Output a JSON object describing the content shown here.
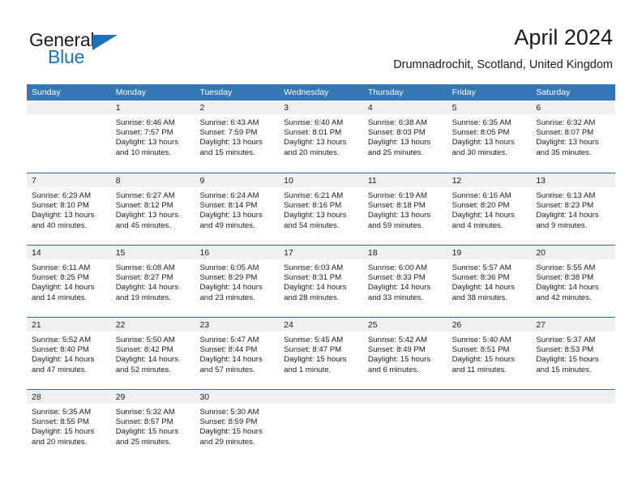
{
  "brand": {
    "word_one": "General",
    "word_two": "Blue",
    "triangle_color": "#1b72b8"
  },
  "header": {
    "title": "April 2024",
    "subtitle": "Drumnadrochit, Scotland, United Kingdom"
  },
  "theme": {
    "header_row_bg": "#3576b4",
    "week_separator": "#2b6ca9",
    "day_number_strip_bg": "#f0f0f0",
    "text": "#1b1b1b"
  },
  "weekday_headers": [
    "Sunday",
    "Monday",
    "Tuesday",
    "Wednesday",
    "Thursday",
    "Friday",
    "Saturday"
  ],
  "weeks": [
    [
      {
        "day": "",
        "sunrise": "",
        "sunset": "",
        "daylight_line1": "",
        "daylight_line2": "",
        "empty": true
      },
      {
        "day": "1",
        "sunrise": "Sunrise: 6:46 AM",
        "sunset": "Sunset: 7:57 PM",
        "daylight_line1": "Daylight: 13 hours",
        "daylight_line2": "and 10 minutes."
      },
      {
        "day": "2",
        "sunrise": "Sunrise: 6:43 AM",
        "sunset": "Sunset: 7:59 PM",
        "daylight_line1": "Daylight: 13 hours",
        "daylight_line2": "and 15 minutes."
      },
      {
        "day": "3",
        "sunrise": "Sunrise: 6:40 AM",
        "sunset": "Sunset: 8:01 PM",
        "daylight_line1": "Daylight: 13 hours",
        "daylight_line2": "and 20 minutes."
      },
      {
        "day": "4",
        "sunrise": "Sunrise: 6:38 AM",
        "sunset": "Sunset: 8:03 PM",
        "daylight_line1": "Daylight: 13 hours",
        "daylight_line2": "and 25 minutes."
      },
      {
        "day": "5",
        "sunrise": "Sunrise: 6:35 AM",
        "sunset": "Sunset: 8:05 PM",
        "daylight_line1": "Daylight: 13 hours",
        "daylight_line2": "and 30 minutes."
      },
      {
        "day": "6",
        "sunrise": "Sunrise: 6:32 AM",
        "sunset": "Sunset: 8:07 PM",
        "daylight_line1": "Daylight: 13 hours",
        "daylight_line2": "and 35 minutes."
      }
    ],
    [
      {
        "day": "7",
        "sunrise": "Sunrise: 6:29 AM",
        "sunset": "Sunset: 8:10 PM",
        "daylight_line1": "Daylight: 13 hours",
        "daylight_line2": "and 40 minutes."
      },
      {
        "day": "8",
        "sunrise": "Sunrise: 6:27 AM",
        "sunset": "Sunset: 8:12 PM",
        "daylight_line1": "Daylight: 13 hours",
        "daylight_line2": "and 45 minutes."
      },
      {
        "day": "9",
        "sunrise": "Sunrise: 6:24 AM",
        "sunset": "Sunset: 8:14 PM",
        "daylight_line1": "Daylight: 13 hours",
        "daylight_line2": "and 49 minutes."
      },
      {
        "day": "10",
        "sunrise": "Sunrise: 6:21 AM",
        "sunset": "Sunset: 8:16 PM",
        "daylight_line1": "Daylight: 13 hours",
        "daylight_line2": "and 54 minutes."
      },
      {
        "day": "11",
        "sunrise": "Sunrise: 6:19 AM",
        "sunset": "Sunset: 8:18 PM",
        "daylight_line1": "Daylight: 13 hours",
        "daylight_line2": "and 59 minutes."
      },
      {
        "day": "12",
        "sunrise": "Sunrise: 6:16 AM",
        "sunset": "Sunset: 8:20 PM",
        "daylight_line1": "Daylight: 14 hours",
        "daylight_line2": "and 4 minutes."
      },
      {
        "day": "13",
        "sunrise": "Sunrise: 6:13 AM",
        "sunset": "Sunset: 8:23 PM",
        "daylight_line1": "Daylight: 14 hours",
        "daylight_line2": "and 9 minutes."
      }
    ],
    [
      {
        "day": "14",
        "sunrise": "Sunrise: 6:11 AM",
        "sunset": "Sunset: 8:25 PM",
        "daylight_line1": "Daylight: 14 hours",
        "daylight_line2": "and 14 minutes."
      },
      {
        "day": "15",
        "sunrise": "Sunrise: 6:08 AM",
        "sunset": "Sunset: 8:27 PM",
        "daylight_line1": "Daylight: 14 hours",
        "daylight_line2": "and 19 minutes."
      },
      {
        "day": "16",
        "sunrise": "Sunrise: 6:05 AM",
        "sunset": "Sunset: 8:29 PM",
        "daylight_line1": "Daylight: 14 hours",
        "daylight_line2": "and 23 minutes."
      },
      {
        "day": "17",
        "sunrise": "Sunrise: 6:03 AM",
        "sunset": "Sunset: 8:31 PM",
        "daylight_line1": "Daylight: 14 hours",
        "daylight_line2": "and 28 minutes."
      },
      {
        "day": "18",
        "sunrise": "Sunrise: 6:00 AM",
        "sunset": "Sunset: 8:33 PM",
        "daylight_line1": "Daylight: 14 hours",
        "daylight_line2": "and 33 minutes."
      },
      {
        "day": "19",
        "sunrise": "Sunrise: 5:57 AM",
        "sunset": "Sunset: 8:36 PM",
        "daylight_line1": "Daylight: 14 hours",
        "daylight_line2": "and 38 minutes."
      },
      {
        "day": "20",
        "sunrise": "Sunrise: 5:55 AM",
        "sunset": "Sunset: 8:38 PM",
        "daylight_line1": "Daylight: 14 hours",
        "daylight_line2": "and 42 minutes."
      }
    ],
    [
      {
        "day": "21",
        "sunrise": "Sunrise: 5:52 AM",
        "sunset": "Sunset: 8:40 PM",
        "daylight_line1": "Daylight: 14 hours",
        "daylight_line2": "and 47 minutes."
      },
      {
        "day": "22",
        "sunrise": "Sunrise: 5:50 AM",
        "sunset": "Sunset: 8:42 PM",
        "daylight_line1": "Daylight: 14 hours",
        "daylight_line2": "and 52 minutes."
      },
      {
        "day": "23",
        "sunrise": "Sunrise: 5:47 AM",
        "sunset": "Sunset: 8:44 PM",
        "daylight_line1": "Daylight: 14 hours",
        "daylight_line2": "and 57 minutes."
      },
      {
        "day": "24",
        "sunrise": "Sunrise: 5:45 AM",
        "sunset": "Sunset: 8:47 PM",
        "daylight_line1": "Daylight: 15 hours",
        "daylight_line2": "and 1 minute."
      },
      {
        "day": "25",
        "sunrise": "Sunrise: 5:42 AM",
        "sunset": "Sunset: 8:49 PM",
        "daylight_line1": "Daylight: 15 hours",
        "daylight_line2": "and 6 minutes."
      },
      {
        "day": "26",
        "sunrise": "Sunrise: 5:40 AM",
        "sunset": "Sunset: 8:51 PM",
        "daylight_line1": "Daylight: 15 hours",
        "daylight_line2": "and 11 minutes."
      },
      {
        "day": "27",
        "sunrise": "Sunrise: 5:37 AM",
        "sunset": "Sunset: 8:53 PM",
        "daylight_line1": "Daylight: 15 hours",
        "daylight_line2": "and 15 minutes."
      }
    ],
    [
      {
        "day": "28",
        "sunrise": "Sunrise: 5:35 AM",
        "sunset": "Sunset: 8:55 PM",
        "daylight_line1": "Daylight: 15 hours",
        "daylight_line2": "and 20 minutes."
      },
      {
        "day": "29",
        "sunrise": "Sunrise: 5:32 AM",
        "sunset": "Sunset: 8:57 PM",
        "daylight_line1": "Daylight: 15 hours",
        "daylight_line2": "and 25 minutes."
      },
      {
        "day": "30",
        "sunrise": "Sunrise: 5:30 AM",
        "sunset": "Sunset: 8:59 PM",
        "daylight_line1": "Daylight: 15 hours",
        "daylight_line2": "and 29 minutes."
      },
      {
        "day": "",
        "sunrise": "",
        "sunset": "",
        "daylight_line1": "",
        "daylight_line2": "",
        "empty": true
      },
      {
        "day": "",
        "sunrise": "",
        "sunset": "",
        "daylight_line1": "",
        "daylight_line2": "",
        "empty": true
      },
      {
        "day": "",
        "sunrise": "",
        "sunset": "",
        "daylight_line1": "",
        "daylight_line2": "",
        "empty": true
      },
      {
        "day": "",
        "sunrise": "",
        "sunset": "",
        "daylight_line1": "",
        "daylight_line2": "",
        "empty": true
      }
    ]
  ]
}
